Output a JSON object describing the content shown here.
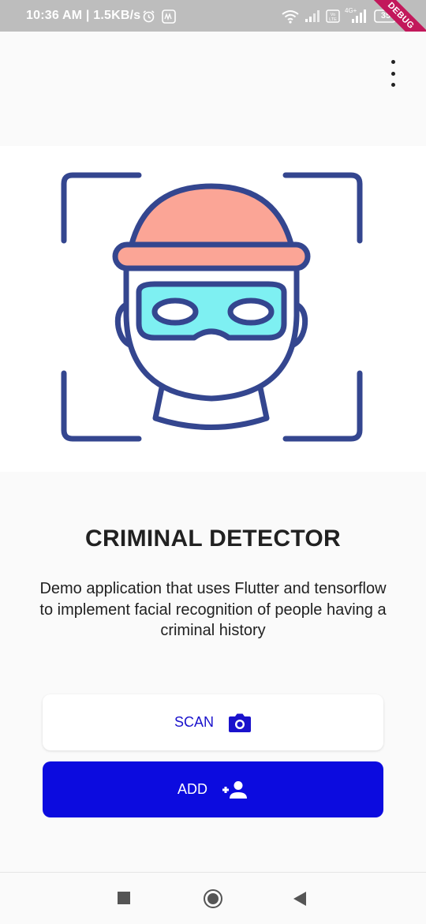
{
  "status_bar": {
    "time_speed": "10:36 AM | 1.5KB/s",
    "icons": [
      "alarm-icon",
      "notification-icon",
      "wifi-icon",
      "signal-icon",
      "volte-icon",
      "4g-signal-icon",
      "battery-icon"
    ],
    "battery": "35",
    "debug_banner": "DEBUG"
  },
  "app_bar": {
    "menu_icon": "more-vert-icon"
  },
  "hero": {
    "icon": "criminal-face-scan-illustration"
  },
  "main": {
    "title": "CRIMINAL DETECTOR",
    "description": "Demo application that uses Flutter and tensorflow to implement facial recognition of people having a criminal history"
  },
  "buttons": {
    "scan_label": "SCAN",
    "scan_icon": "camera-icon",
    "add_label": "ADD",
    "add_icon": "person-add-icon"
  },
  "nav_bar": {
    "items": [
      "recents-icon",
      "home-icon",
      "back-icon"
    ]
  },
  "colors": {
    "primary": "#0c0bdf",
    "scan_text": "#1a12cc",
    "illustration_stroke": "#34468f",
    "hat": "#fba596",
    "mask": "#7ef0f2",
    "status_bar": "#bdbdbd"
  }
}
